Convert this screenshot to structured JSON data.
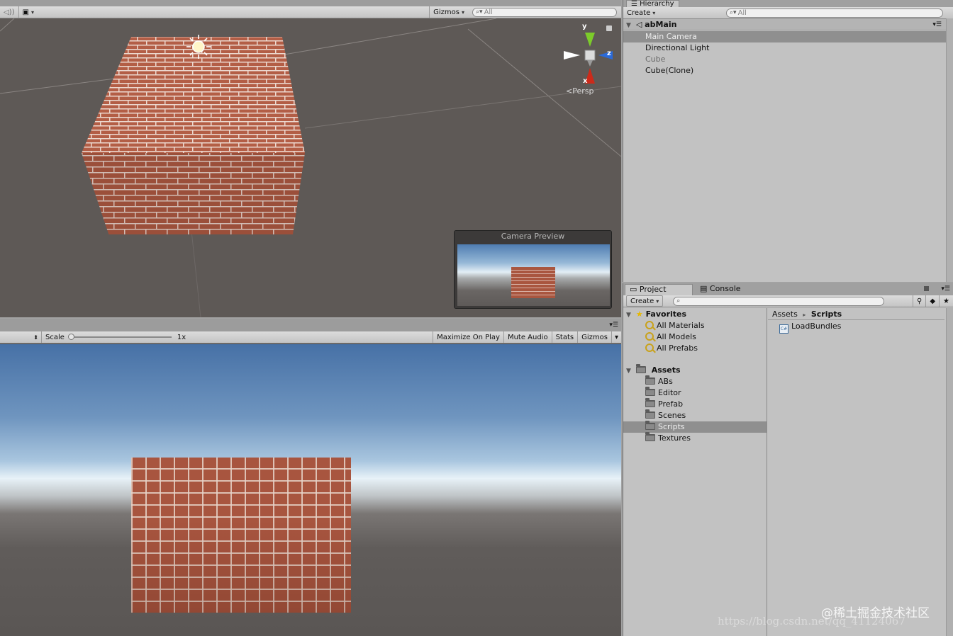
{
  "scene": {
    "gizmos_label": "Gizmos",
    "search_placeholder": "All",
    "axis_y": "y",
    "axis_z": "z",
    "axis_x": "x",
    "persp_label": "Persp",
    "camera_preview_title": "Camera Preview"
  },
  "hierarchy": {
    "tab_label": "Hierarchy",
    "create_label": "Create",
    "search_placeholder": "All",
    "scene_name": "abMain",
    "items": [
      {
        "label": "Main Camera",
        "color": "#eeeeee",
        "selected": true
      },
      {
        "label": "Directional Light",
        "color": "#111111"
      },
      {
        "label": "Cube",
        "color": "#6a6a6a"
      },
      {
        "label": "Cube(Clone)",
        "color": "#111111"
      }
    ]
  },
  "game": {
    "scale_label": "Scale",
    "scale_value": "1x",
    "maximize_label": "Maximize On Play",
    "mute_label": "Mute Audio",
    "stats_label": "Stats",
    "gizmos_label": "Gizmos"
  },
  "project": {
    "tab_project": "Project",
    "tab_console": "Console",
    "create_label": "Create",
    "favorites_label": "Favorites",
    "favorites": [
      "All Materials",
      "All Models",
      "All Prefabs"
    ],
    "assets_label": "Assets",
    "folders": [
      "ABs",
      "Editor",
      "Prefab",
      "Scenes",
      "Scripts",
      "Textures"
    ],
    "selected_folder": "Scripts",
    "breadcrumb_root": "Assets",
    "breadcrumb_current": "Scripts",
    "files": [
      "LoadBundles"
    ]
  },
  "watermark": {
    "brand": "@稀土掘金技术社区",
    "url": "https://blog.csdn.net/qq_41124067"
  }
}
